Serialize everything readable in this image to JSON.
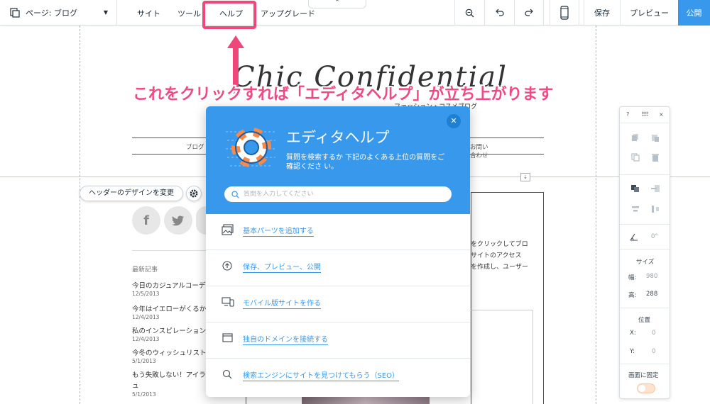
{
  "topbar": {
    "page_selector": "ページ: ブログ",
    "menu": {
      "site": "サイト",
      "tools": "ツール",
      "help": "ヘルプ",
      "upgrade": "アップグレード"
    },
    "collapse_glyph": "⌃",
    "save": "保存",
    "preview": "プレビュー",
    "publish": "公開",
    "publish_color": "#3899ec"
  },
  "canvas": {
    "logo_text": "Chic Confidential",
    "logo_subtitle": "ファッション・コスメブログ",
    "nav_blog": "ブログ",
    "nav_contact": "お問い合わせ",
    "header_design_button": "ヘッダーのデザインを変更",
    "social": [
      "f",
      "t"
    ],
    "recent_posts_heading": "最新記事",
    "posts": [
      {
        "title": "今日のカジュアルコーデ",
        "date": "12/5/2013"
      },
      {
        "title": "今年はイエローがくるか",
        "date": "12/4/2013"
      },
      {
        "title": "私のインスピレーション",
        "date": "12/4/2013"
      },
      {
        "title": "今冬のウィッシュリスト",
        "date": "5/1/2013"
      },
      {
        "title": "もう失敗しない！アイラ",
        "title_wrap": "ュ",
        "date": "5/1/2013"
      }
    ],
    "right_text": [
      "をクリックしてブロ",
      "サイトのアクセス",
      "を作成し、ユーザー"
    ]
  },
  "help_panel": {
    "title": "エディタヘルプ",
    "description": "質問を検索するか 下記のよくある上位の質問をご確認くださ い。",
    "search_placeholder": "質問を入力してください",
    "close_glyph": "✕",
    "items": [
      {
        "label": "基本パーツを追加する",
        "icon": "image-icon"
      },
      {
        "label": "保存、プレビュー、公開",
        "icon": "upload-icon"
      },
      {
        "label": "モバイル版サイトを作る",
        "icon": "devices-icon"
      },
      {
        "label": "独自のドメインを接続する",
        "icon": "browser-window-icon"
      },
      {
        "label": "検索エンジンにサイトを見つけてもらう（SEO）",
        "icon": "search-icon"
      }
    ],
    "header_color": "#3899ec"
  },
  "annotation": {
    "text": "これをクリックすれば「エディタヘルプ」が立ち上がります",
    "color": "#f0477b"
  },
  "tool_panel": {
    "help_glyph": "?",
    "close_glyph": "×",
    "rotation_value": "0°",
    "size_heading": "サイズ",
    "width_label": "幅:",
    "width_value": "980",
    "height_label": "高:",
    "height_value": "288",
    "position_heading": "位置",
    "x_label": "X:",
    "x_value": "0",
    "y_label": "Y:",
    "y_value": "0",
    "pin_label": "画面に固定"
  }
}
